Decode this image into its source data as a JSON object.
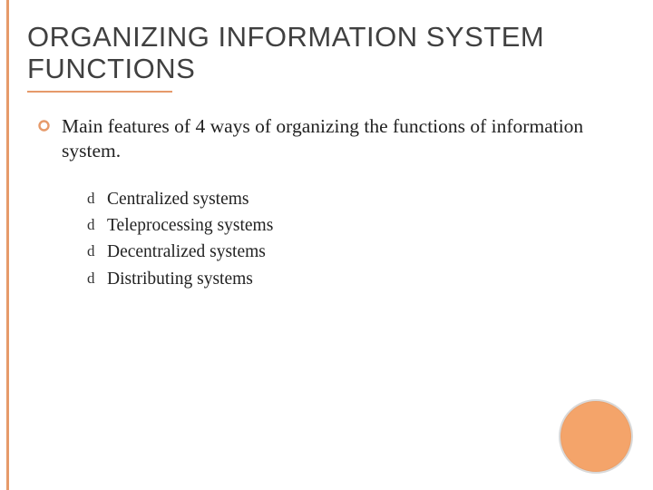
{
  "title": "ORGANIZING INFORMATION SYSTEM FUNCTIONS",
  "body": {
    "main_point": "Main features of 4 ways of organizing the functions of information system.",
    "sub_points": [
      "Centralized systems",
      "Teleprocessing systems",
      "Decentralized systems",
      "Distributing systems"
    ]
  }
}
